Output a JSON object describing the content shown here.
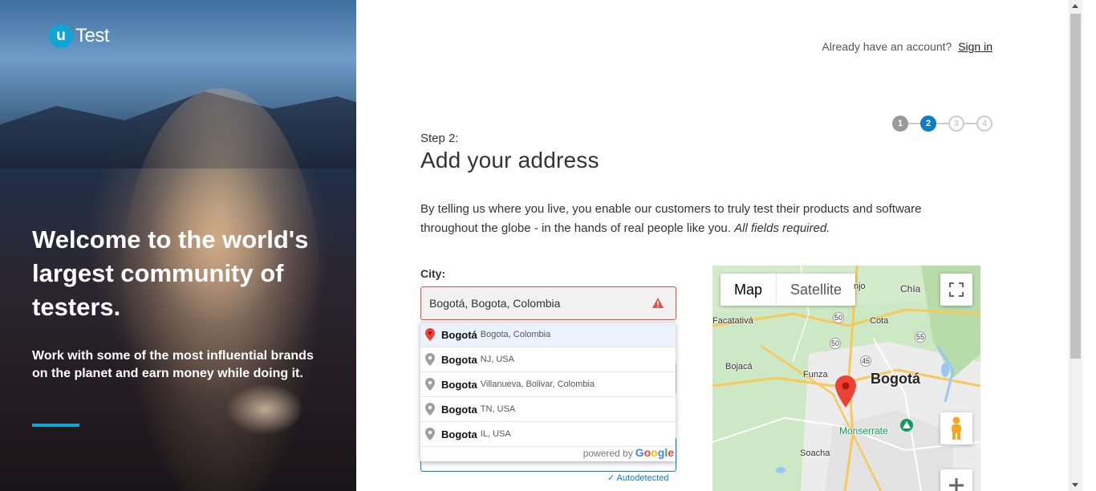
{
  "hero": {
    "logo_u": "u",
    "logo_text": "Test",
    "title": "Welcome to the world's largest community of testers.",
    "subtitle": "Work with some of the most influential brands on the planet and earn money while doing it."
  },
  "header": {
    "already_text": "Already have an account?",
    "sign_in_label": "Sign in"
  },
  "stepper": {
    "steps": [
      "1",
      "2",
      "3",
      "4"
    ],
    "current": 2
  },
  "form": {
    "step_label": "Step 2:",
    "title": "Add your address",
    "description": "By telling us where you live, you enable our customers to truly test their products and software throughout the globe - in the hands of real people like you.",
    "description_em": "All fields required.",
    "city_label": "City:",
    "city_value": "Bogotá, Bogota, Colombia",
    "autodetected": "✓ Autodetected"
  },
  "autocomplete": {
    "items": [
      {
        "main": "Bogotá",
        "secondary": "Bogota, Colombia"
      },
      {
        "main": "Bogota",
        "secondary": "NJ, USA"
      },
      {
        "main": "Bogota",
        "secondary": "Villanueva, Bolivar, Colombia"
      },
      {
        "main": "Bogota",
        "secondary": "TN, USA"
      },
      {
        "main": "Bogota",
        "secondary": "IL, USA"
      }
    ],
    "powered_by": "powered by",
    "google": "Google"
  },
  "map": {
    "type_map": "Map",
    "type_satellite": "Satellite",
    "labels": {
      "chia": "Chía",
      "cota": "Cota",
      "facatativa": "Facatativá",
      "bojaca": "Bojacá",
      "funza": "Funza",
      "bogota": "Bogotá",
      "monserrate": "Monserrate",
      "soacha": "Soacha",
      "tenjo": "njo",
      "r50a": "50",
      "r50b": "50",
      "r45": "45",
      "r55": "55"
    }
  },
  "colors": {
    "accent": "#11a5d6",
    "step_active": "#0b7fc6",
    "error": "#d9534f"
  }
}
